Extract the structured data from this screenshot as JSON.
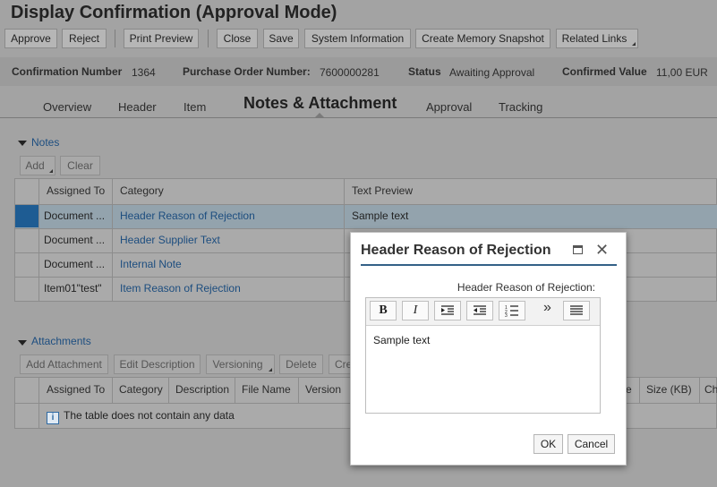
{
  "page": {
    "title": "Display Confirmation (Approval Mode)"
  },
  "toolbar": {
    "approve": "Approve",
    "reject": "Reject",
    "print_preview": "Print Preview",
    "close": "Close",
    "save": "Save",
    "system_information": "System Information",
    "create_memory_snapshot": "Create Memory Snapshot",
    "related_links": "Related Links"
  },
  "header": {
    "confirmation_number_label": "Confirmation Number",
    "confirmation_number": "1364",
    "po_number_label": "Purchase Order Number:",
    "po_number": "7600000281",
    "status_label": "Status",
    "status": "Awaiting Approval",
    "confirmed_value_label": "Confirmed Value",
    "confirmed_value": "11,00 EUR"
  },
  "tabs": [
    "Overview",
    "Header",
    "Item",
    "Notes & Attachment",
    "Approval",
    "Tracking"
  ],
  "notes": {
    "title": "Notes",
    "add_label": "Add",
    "clear_label": "Clear",
    "columns": [
      "Assigned To",
      "Category",
      "Text Preview"
    ],
    "rows": [
      {
        "assigned_to": "Document ...",
        "category": "Header Reason of Rejection",
        "preview": "Sample text"
      },
      {
        "assigned_to": "Document ...",
        "category": "Header Supplier Text",
        "preview": ""
      },
      {
        "assigned_to": "Document ...",
        "category": "Internal Note",
        "preview": ""
      },
      {
        "assigned_to": "Item01\"test\"",
        "category": "Item Reason of Rejection",
        "preview": ""
      }
    ]
  },
  "attachments": {
    "title": "Attachments",
    "buttons": [
      "Add Attachment",
      "Edit Description",
      "Versioning",
      "Delete",
      "Cre"
    ],
    "columns": [
      "Assigned To",
      "Category",
      "Description",
      "File Name",
      "Version",
      "e",
      "Size (KB)",
      "Ch"
    ],
    "empty_message": "The table does not contain any data"
  },
  "dialog": {
    "title": "Header Reason of Rejection",
    "field_label": "Header Reason of Rejection:",
    "editor_text": "Sample text",
    "toolbar_glyphs": {
      "bold": "B",
      "italic": "I",
      "more": "»"
    },
    "ok_label": "OK",
    "cancel_label": "Cancel"
  }
}
